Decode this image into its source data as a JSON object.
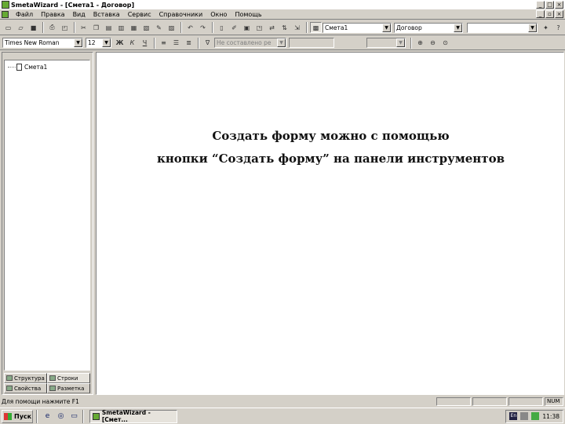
{
  "window": {
    "title": "SmetaWizard - [Смета1 - Договор]"
  },
  "menu": {
    "items": [
      "Файл",
      "Правка",
      "Вид",
      "Вставка",
      "Сервис",
      "Справочники",
      "Окно",
      "Помощь"
    ]
  },
  "toolbar1": {
    "smeta_combo": "Смета1",
    "form_combo": "Договор",
    "extra_combo": ""
  },
  "toolbar2": {
    "font_combo": "Times New Roman",
    "size_combo": "12",
    "bold": "Ж",
    "italic": "К",
    "underline": "Ч",
    "style_combo": "Не составлено ре"
  },
  "tree": {
    "item": "Смета1"
  },
  "panel_tabs": {
    "row1": [
      "Структура",
      "Строки"
    ],
    "row2": [
      "Свойства",
      "Разметка"
    ]
  },
  "main": {
    "line1": "Создать форму можно с помощью",
    "line2": "кнопки “Создать форму” на панели инструментов"
  },
  "statusbar": {
    "text": "Для помощи нажмите F1",
    "num": "NUM"
  },
  "taskbar": {
    "start": "Пуск",
    "task": "SmetaWizard - [Смет...",
    "clock": "11:38",
    "lang": "En"
  }
}
